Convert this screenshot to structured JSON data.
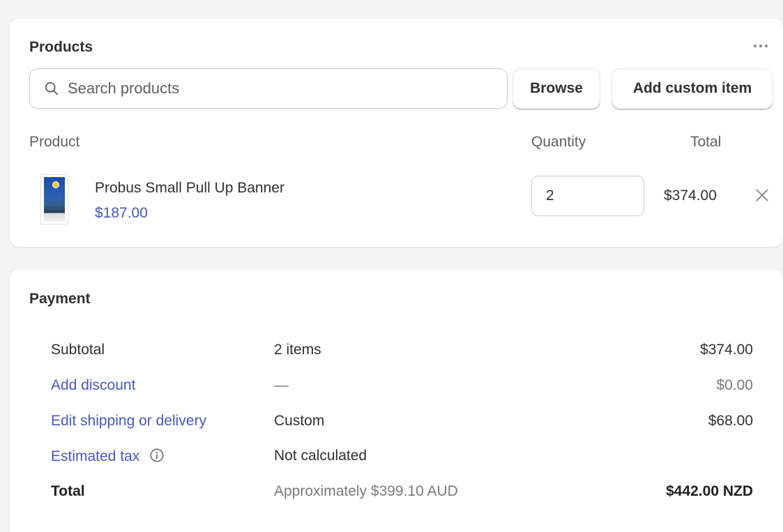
{
  "products": {
    "title": "Products",
    "search_placeholder": "Search products",
    "browse_label": "Browse",
    "custom_item_label": "Add custom item",
    "columns": {
      "product": "Product",
      "quantity": "Quantity",
      "total": "Total"
    },
    "items": [
      {
        "name": "Probus Small Pull Up Banner",
        "price": "$187.00",
        "quantity": "2",
        "total": "$374.00"
      }
    ]
  },
  "payment": {
    "title": "Payment",
    "rows": [
      {
        "label": "Subtotal",
        "desc": "2 items",
        "amount": "$374.00"
      },
      {
        "label": "Add discount",
        "desc": "—",
        "amount": "$0.00"
      },
      {
        "label": "Edit shipping or delivery",
        "desc": "Custom",
        "amount": "$68.00"
      },
      {
        "label": "Estimated tax",
        "desc": "Not calculated",
        "amount": ""
      },
      {
        "label": "Total",
        "desc": "Approximately $399.10 AUD",
        "amount": "$442.00 NZD"
      }
    ]
  },
  "colors": {
    "link": "#4a58b8",
    "text": "#303030",
    "muted": "#616161"
  },
  "icons": {
    "search": "search-icon",
    "more": "more-horizontal-icon",
    "remove": "close-icon",
    "info": "info-icon"
  }
}
